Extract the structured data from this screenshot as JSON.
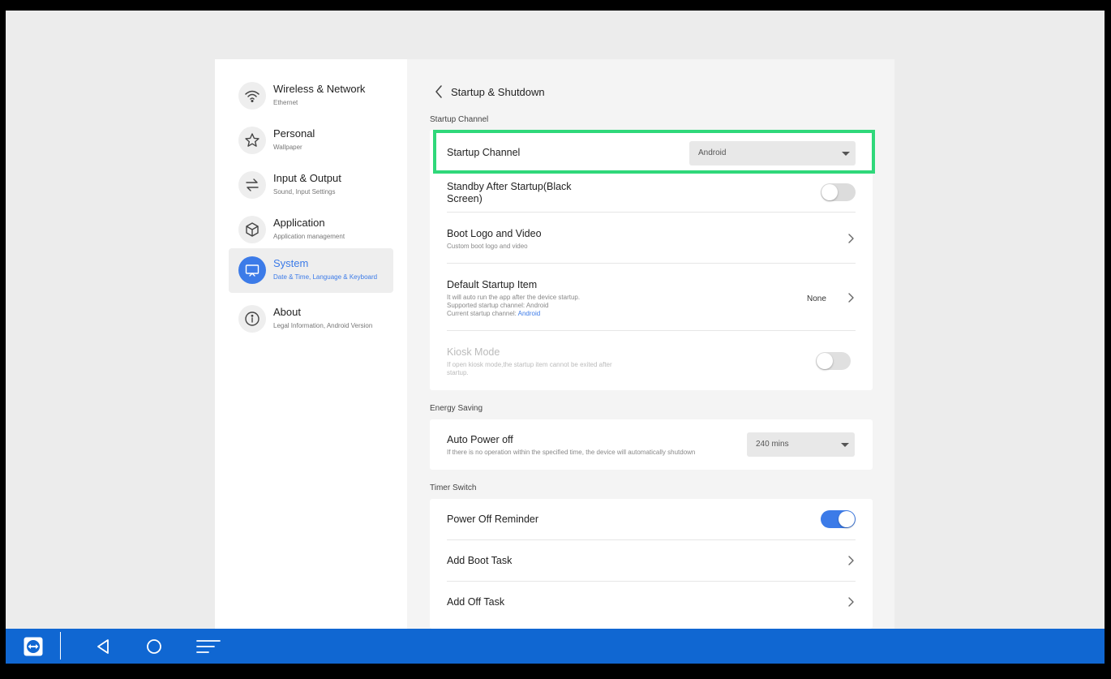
{
  "sidebar": {
    "items": [
      {
        "title": "Wireless & Network",
        "subtitle": "Ethernet",
        "icon": "wifi-icon"
      },
      {
        "title": "Personal",
        "subtitle": "Wallpaper",
        "icon": "star-icon"
      },
      {
        "title": "Input & Output",
        "subtitle": "Sound, Input Settings",
        "icon": "swap-arrows-icon"
      },
      {
        "title": "Application",
        "subtitle": "Application management",
        "icon": "cube-icon"
      },
      {
        "title": "System",
        "subtitle": "Date & Time, Language & Keyboard",
        "icon": "monitor-icon",
        "active": true
      },
      {
        "title": "About",
        "subtitle": "Legal Information, Android Version",
        "icon": "info-icon"
      }
    ]
  },
  "header": {
    "title": "Startup & Shutdown"
  },
  "sections": {
    "startup": {
      "label": "Startup Channel",
      "startup_channel": {
        "title": "Startup Channel",
        "value": "Android"
      },
      "standby": {
        "title": "Standby After Startup(Black Screen)",
        "toggle_on": false
      },
      "boot_logo": {
        "title": "Boot Logo and Video",
        "subtitle": "Custom boot logo and video"
      },
      "default_item": {
        "title": "Default Startup Item",
        "line1": "It will auto run the app after the device startup.",
        "line2": "Supported startup channel: Android",
        "line3_prefix": "Current startup channel: ",
        "line3_value": "Android",
        "value": "None"
      },
      "kiosk": {
        "title": "Kiosk Mode",
        "subtitle": "If open kiosk mode,the startup item cannot be exited after startup.",
        "toggle_on": false,
        "disabled": true
      }
    },
    "energy": {
      "label": "Energy Saving",
      "auto_power_off": {
        "title": "Auto Power off",
        "subtitle": "If there is no operation within the specified time, the device will automatically shutdown",
        "value": "240 mins"
      }
    },
    "timer": {
      "label": "Timer Switch",
      "power_off_reminder": {
        "title": "Power Off Reminder",
        "toggle_on": true
      },
      "add_boot_task": {
        "title": "Add Boot Task"
      },
      "add_off_task": {
        "title": "Add Off Task"
      }
    }
  },
  "taskbar": {
    "items": [
      "teamviewer-icon",
      "back-nav-icon",
      "home-nav-icon",
      "menu-nav-icon"
    ]
  },
  "colors": {
    "accent": "#3c7be8",
    "highlight": "#2fd87a",
    "taskbar": "#1067d2"
  }
}
